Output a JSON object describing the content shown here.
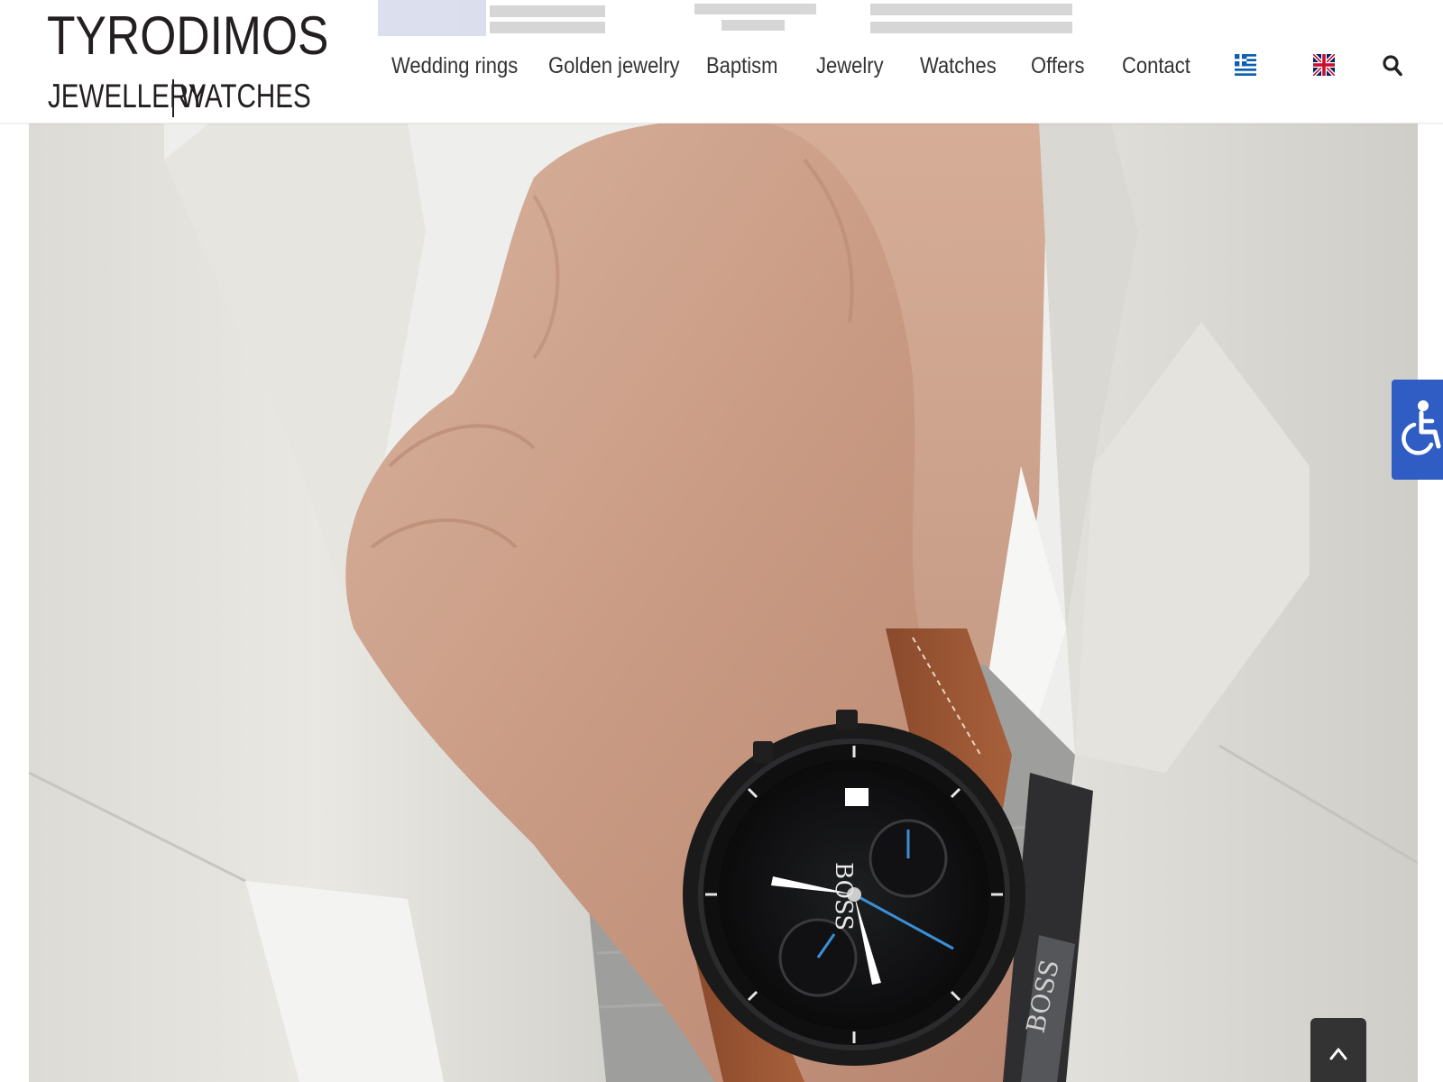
{
  "brand": {
    "name": "TYRODIMOS",
    "tagline_left": "JEWELLERY",
    "tagline_right": "WATCHES"
  },
  "nav": {
    "items": [
      {
        "label": "Wedding rings"
      },
      {
        "label": "Golden jewelry"
      },
      {
        "label": "Baptism"
      },
      {
        "label": "Jewelry"
      },
      {
        "label": "Watches"
      },
      {
        "label": "Offers"
      },
      {
        "label": "Contact"
      }
    ],
    "languages": [
      {
        "icon": "greek-flag-icon"
      },
      {
        "icon": "uk-flag-icon"
      }
    ],
    "search_icon": "search-icon"
  },
  "hero": {
    "watch_brand": "BOSS",
    "bracelet_brand": "BOSS"
  },
  "accessibility": {
    "icon": "wheelchair-icon",
    "color": "#2f5dc4"
  },
  "back_to_top": {
    "icon": "chevron-up-icon",
    "color": "#333333"
  },
  "colors": {
    "text": "#333333",
    "logo": "#231f20",
    "header_bg": "#ffffff"
  }
}
